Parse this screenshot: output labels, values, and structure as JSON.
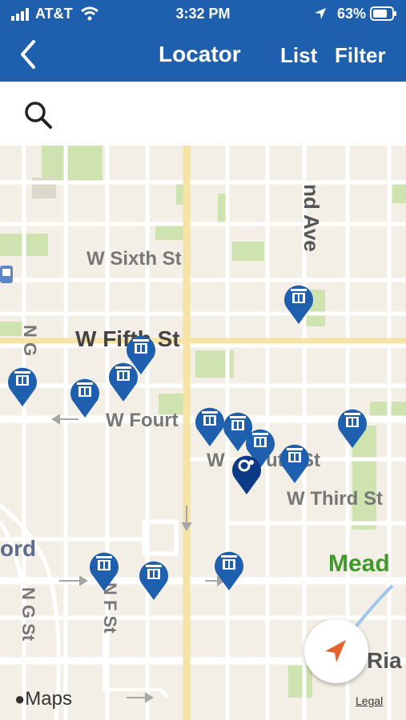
{
  "status_bar": {
    "carrier": "AT&T",
    "time": "3:32 PM",
    "battery": "63%"
  },
  "nav": {
    "title": "Locator",
    "list_label": "List",
    "filter_label": "Filter"
  },
  "search": {
    "placeholder": ""
  },
  "map": {
    "streets": {
      "sixth": "W Sixth St",
      "fifth": "W Fifth St",
      "fourth": "W Fourt",
      "fourth_b": "W",
      "fourth_c": "uth St",
      "third": "W Third St",
      "ave": "nd Ave",
      "ng": "N G",
      "ng2": "N G St",
      "nf": "N F St",
      "ord": "ord",
      "mead": "Mead",
      "ria": "Ria"
    },
    "attribution": "Maps",
    "legal": "Legal"
  },
  "colors": {
    "brand": "#1e5fae",
    "pin": "#1e5fae",
    "pin_selected": "#0d3a86",
    "park": "#cfe3b0",
    "water": "#9fc6ea",
    "location_arrow": "#e5622b"
  }
}
